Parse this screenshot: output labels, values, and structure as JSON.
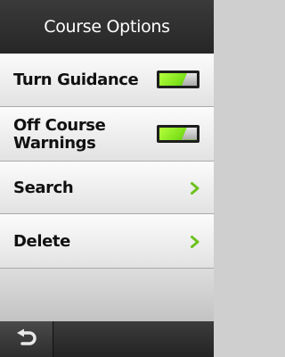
{
  "header": {
    "title": "Course Options"
  },
  "menu": {
    "items": [
      {
        "label": "Turn Guidance",
        "control": "toggle",
        "enabled": true
      },
      {
        "label": "Off Course\nWarnings",
        "control": "toggle",
        "enabled": true
      },
      {
        "label": "Search",
        "control": "chevron-right-icon"
      },
      {
        "label": "Delete",
        "control": "chevron-right-icon"
      }
    ]
  },
  "footer": {
    "back_icon": "back-arrow-icon"
  },
  "colors": {
    "toggle_on": "#8ae61e",
    "chevron": "#6cc21c",
    "header_bg": "#2d2d2d"
  }
}
